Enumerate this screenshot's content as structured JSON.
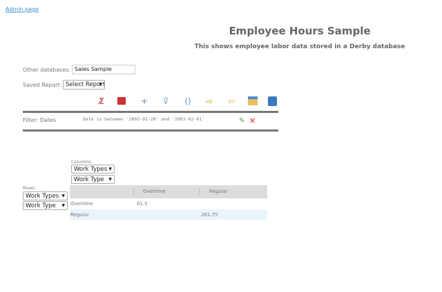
{
  "header": {
    "admin_link": "Admin page",
    "title": "Employee Hours Sample",
    "subtitle": "This shows employee labor data stored in a Derby database"
  },
  "form": {
    "other_db_label": "Other databases:",
    "other_db_value": "Sales Sample",
    "saved_report_label": "Saved Report:",
    "saved_report_value": "Select Report"
  },
  "toolbar": {
    "icons": [
      "hide-totals-icon",
      "swap-axes-icon",
      "add-icon",
      "add-filter-icon",
      "refresh-icon",
      "remove-column-icon",
      "collapse-icon",
      "chart-icon",
      "save-icon"
    ]
  },
  "filter": {
    "label": "Filter: Dates",
    "text": "Date is between '2003-01-28' and '2003-02-01'"
  },
  "pivot": {
    "columns_label": "Columns:",
    "column_selects": [
      "Work Types",
      "Work Type"
    ],
    "rows_label": "Rows:",
    "row_selects": [
      "Work Types",
      "Work Type"
    ],
    "headers": [
      "",
      "Overtime",
      "Regular"
    ],
    "rows": [
      {
        "label": "Overtime",
        "overtime": "61.5",
        "regular": ""
      },
      {
        "label": "Regular",
        "overtime": "",
        "regular": "261.75"
      }
    ]
  },
  "colors": {
    "link": "#3b8fd0",
    "row_highlight": "#eaf4fb",
    "header_bg": "#dcdcdc"
  }
}
